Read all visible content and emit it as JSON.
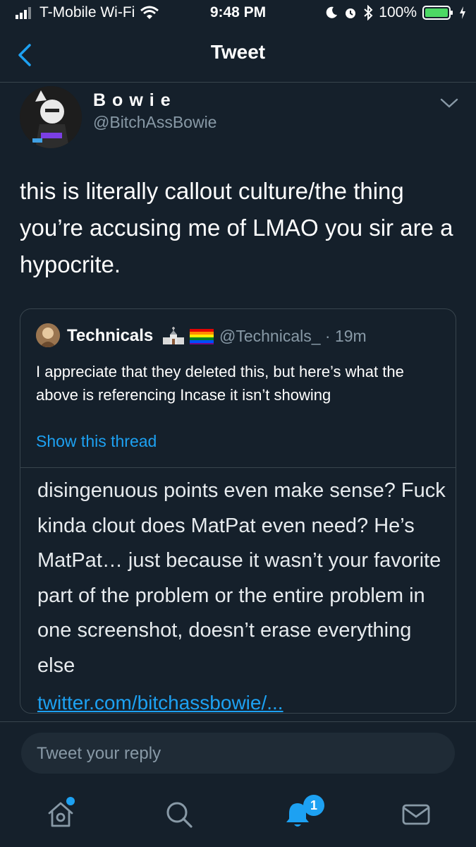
{
  "status_bar": {
    "carrier": "T-Mobile Wi-Fi",
    "time": "9:48 PM",
    "battery": "100%"
  },
  "header": {
    "title": "Tweet"
  },
  "tweet": {
    "author_name": "Bowie",
    "author_handle": "@BitchAssBowie",
    "text": "this is literally callout culture/the thing you’re accusing me of LMAO you sir are a hypocrite."
  },
  "quoted_tweet": {
    "name": "Technicals",
    "handle_time": "@Technicals_ · 19m",
    "text": "I appreciate that they deleted this, but here’s what the above is referencing Incase it isn’t showing",
    "show_thread": "Show this thread",
    "image_text": "disingenuous points even make sense? Fuck kinda clout does MatPat even need? He’s MatPat… just because it wasn’t your favorite part of the problem or the entire problem in one screenshot, doesn’t erase everything else",
    "link": "twitter.com/bitchassbowie/..."
  },
  "reply": {
    "placeholder": "Tweet your reply"
  },
  "tab_bar": {
    "notifications_count": "1"
  },
  "colors": {
    "background": "#15202b",
    "accent": "#1da1f2",
    "secondary_text": "#8899a6",
    "border": "#38444d",
    "battery": "#4cd964"
  },
  "icons": [
    "signal-icon",
    "wifi-icon",
    "moon-icon",
    "alarm-icon",
    "bluetooth-icon",
    "battery-icon",
    "charging-icon",
    "back-chevron-icon",
    "chevron-down-icon",
    "home-icon",
    "search-icon",
    "notifications-icon",
    "messages-icon"
  ]
}
